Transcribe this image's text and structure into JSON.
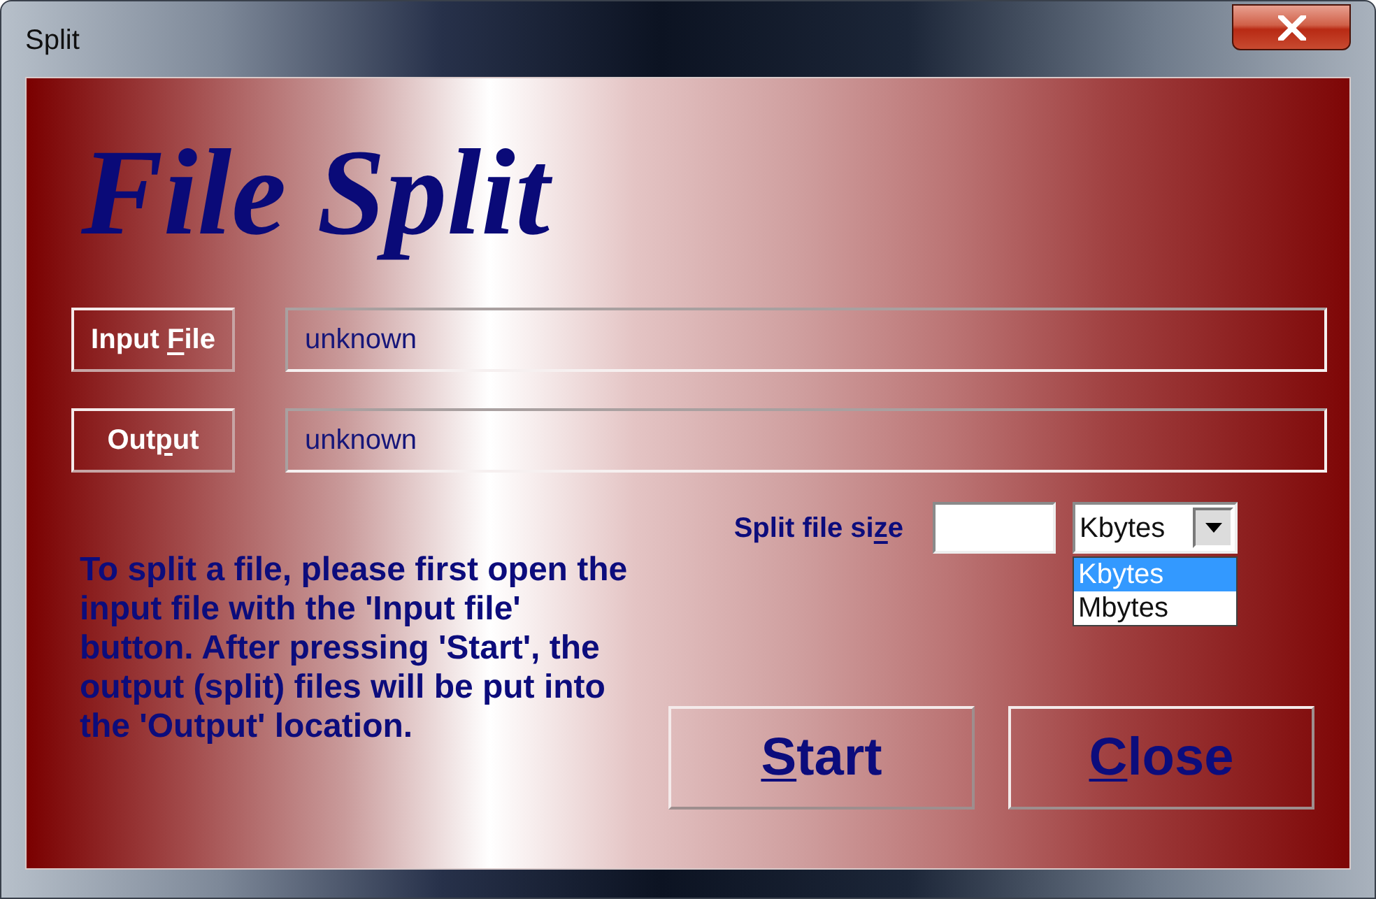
{
  "window": {
    "title": "Split"
  },
  "header": {
    "title": "File Split"
  },
  "paths": [
    {
      "button": {
        "label": "Input File"
      },
      "value": "unknown"
    },
    {
      "button": {
        "label": "Output"
      },
      "value": "unknown"
    }
  ],
  "split_size": {
    "label": "Split file size",
    "unit": {
      "value": "Kbytes",
      "expanded": true,
      "options": [
        {
          "label": "Kbytes",
          "selected": true
        },
        {
          "label": "Mbytes",
          "selected": false
        }
      ]
    }
  },
  "instructions": "To split a file, please first open the input file with the 'Input file' button. After pressing 'Start', the output (split) files will be put into the 'Output' location.",
  "actions": [
    {
      "label": "Start"
    },
    {
      "label": "Close"
    }
  ]
}
